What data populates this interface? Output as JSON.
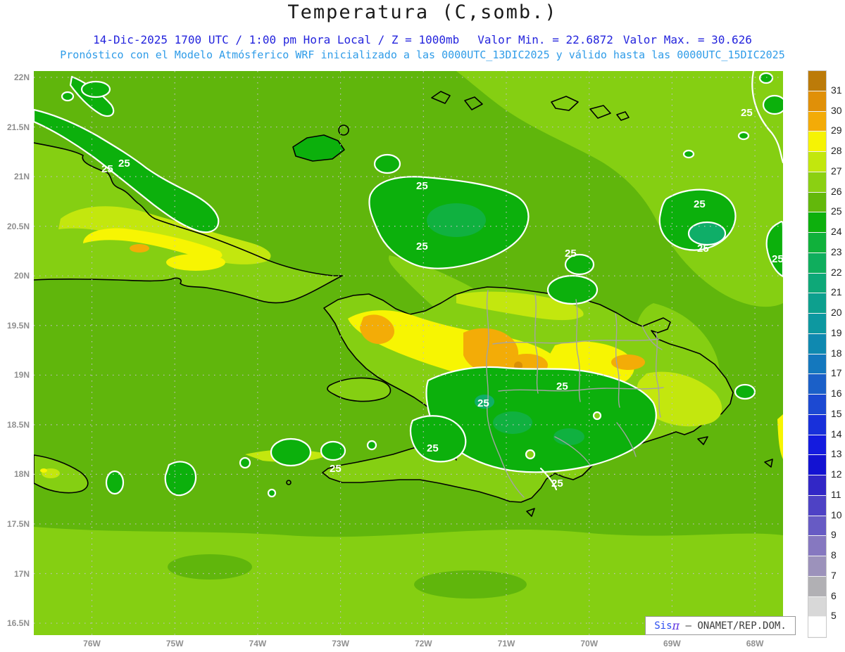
{
  "header": {
    "title": "Temperatura (C,somb.)",
    "datetime": "14-Dic-2025  1700 UTC / 1:00 pm Hora Local / Z = 1000mb",
    "value_min": "Valor Min. = 22.6872",
    "value_max": "Valor Max. = 30.626",
    "model_line": "Pronóstico con el Modelo Atmósferico WRF inicializado a las 0000UTC_13DIC2025 y válido hasta las  0000UTC_15DIC2025"
  },
  "map": {
    "contour_label": "25",
    "axis": {
      "lat_labels": [
        "22N",
        "21.5N",
        "21N",
        "20.5N",
        "20N",
        "19.5N",
        "19N",
        "18.5N",
        "18N",
        "17.5N",
        "17N",
        "16.5N"
      ],
      "lon_labels": [
        "76W",
        "75W",
        "74W",
        "73W",
        "72W",
        "71W",
        "70W",
        "69W",
        "68W"
      ]
    }
  },
  "colorbar": {
    "ticks": [
      "31",
      "30",
      "29",
      "28",
      "27",
      "26",
      "25",
      "24",
      "23",
      "22",
      "21",
      "20",
      "19",
      "18",
      "17",
      "16",
      "15",
      "14",
      "13",
      "12",
      "11",
      "10",
      "9",
      "8",
      "7",
      "6",
      "5"
    ],
    "cells": [
      "#bc7b09",
      "#e09008",
      "#f3ab07",
      "#f6f304",
      "#c2e70d",
      "#8bd012",
      "#63b80b",
      "#0db00d",
      "#10b13b",
      "#0fae5d",
      "#0ea878",
      "#0da08e",
      "#0d98a0",
      "#0f89b0",
      "#1478be",
      "#1b60c8",
      "#1c49d2",
      "#1830da",
      "#141bdf",
      "#1312d2",
      "#3227c6",
      "#4e42c5",
      "#675bc4",
      "#8678c0",
      "#9c92bb",
      "#b1b0b4",
      "#d8d8d8",
      "#ffffff"
    ]
  },
  "attribution": {
    "brand": "Sis",
    "symbol": "π",
    "text": " – ONAMET/REP.DOM."
  },
  "palette": {
    "sea": "#60b60c",
    "band26": "#85cf12",
    "band27": "#c3e70e",
    "yellow28": "#f7f502",
    "orange29": "#f3ac07",
    "orange30": "#d98f06",
    "green24": "#0cb00c",
    "green23": "#10b140",
    "teal22": "#0fae68",
    "coast": "#000000",
    "prov": "#a3a3a3",
    "grid": "#bfbfbf",
    "axisText": "#8f8f8f",
    "headerBlue": "#2424dd",
    "headerCyan": "#2f9ce8",
    "title": "#1a1a1a"
  }
}
